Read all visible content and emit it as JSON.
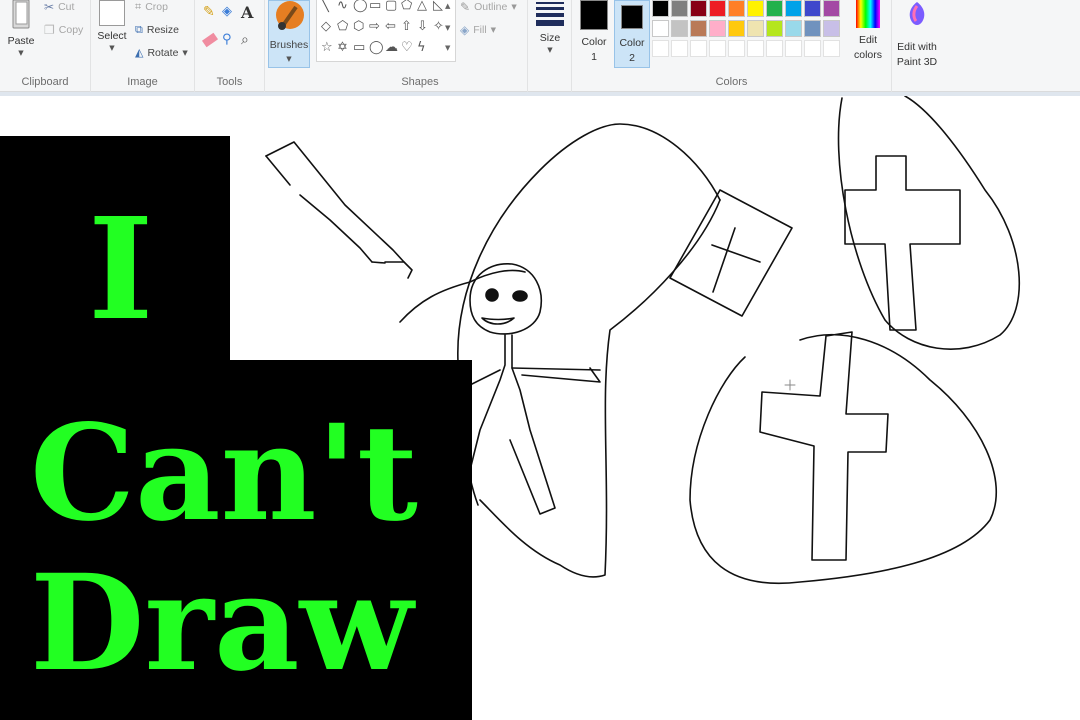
{
  "ribbon": {
    "clipboard": {
      "paste": "Paste",
      "cut": "Cut",
      "copy": "Copy",
      "label": "Clipboard"
    },
    "image": {
      "select": "Select",
      "crop": "Crop",
      "resize": "Resize",
      "rotate": "Rotate",
      "label": "Image"
    },
    "tools": {
      "label": "Tools",
      "text_tool": "A"
    },
    "brushes": {
      "label": "Brushes"
    },
    "shapes": {
      "outline": "Outline",
      "fill": "Fill",
      "label": "Shapes"
    },
    "size": {
      "label": "Size"
    },
    "colors": {
      "color1_line1": "Color",
      "color1_line2": "1",
      "color2_line1": "Color",
      "color2_line2": "2",
      "edit_line1": "Edit",
      "edit_line2": "colors",
      "label": "Colors",
      "palette_row1": [
        "#000000",
        "#7f7f7f",
        "#880015",
        "#ed1c24",
        "#ff7f27",
        "#fff200",
        "#22b14c",
        "#00a2e8",
        "#3f48cc",
        "#a349a4"
      ],
      "palette_row2": [
        "#ffffff",
        "#c3c3c3",
        "#b97a57",
        "#ffaec9",
        "#ffc90e",
        "#efe4b0",
        "#b5e61d",
        "#99d9ea",
        "#7092be",
        "#c8bfe7"
      ]
    },
    "paint3d": {
      "line1": "Edit with",
      "line2": "Paint 3D"
    }
  },
  "overlay": {
    "word1": "I",
    "word2": "Can't",
    "word3": "Draw",
    "text_color": "#22ff22"
  }
}
